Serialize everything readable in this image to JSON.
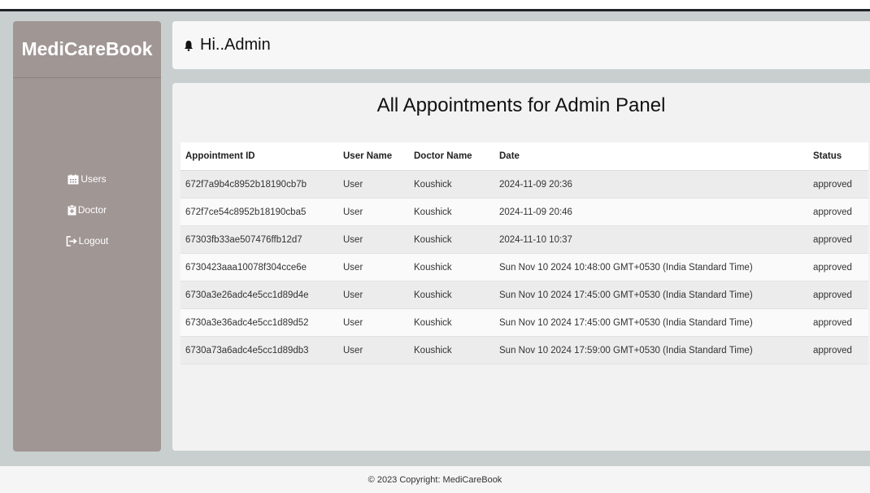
{
  "brand": "MediCareBook",
  "sidebar": {
    "items": [
      {
        "label": "Users",
        "icon": "calendar-icon"
      },
      {
        "label": "Doctor",
        "icon": "clipboard-icon"
      },
      {
        "label": "Logout",
        "icon": "logout-icon"
      }
    ]
  },
  "header": {
    "greeting": "Hi..Admin",
    "icon": "bell-icon"
  },
  "main": {
    "title": "All Appointments for Admin Panel",
    "columns": [
      "Appointment ID",
      "User Name",
      "Doctor Name",
      "Date",
      "Status"
    ],
    "rows": [
      [
        "672f7a9b4c8952b18190cb7b",
        "User",
        "Koushick",
        "2024-11-09 20:36",
        "approved"
      ],
      [
        "672f7ce54c8952b18190cba5",
        "User",
        "Koushick",
        "2024-11-09 20:46",
        "approved"
      ],
      [
        "67303fb33ae507476ffb12d7",
        "User",
        "Koushick",
        "2024-11-10 10:37",
        "approved"
      ],
      [
        "6730423aaa10078f304cce6e",
        "User",
        "Koushick",
        "Sun Nov 10 2024 10:48:00 GMT+0530 (India Standard Time)",
        "approved"
      ],
      [
        "6730a3e26adc4e5cc1d89d4e",
        "User",
        "Koushick",
        "Sun Nov 10 2024 17:45:00 GMT+0530 (India Standard Time)",
        "approved"
      ],
      [
        "6730a3e36adc4e5cc1d89d52",
        "User",
        "Koushick",
        "Sun Nov 10 2024 17:45:00 GMT+0530 (India Standard Time)",
        "approved"
      ],
      [
        "6730a73a6adc4e5cc1d89db3",
        "User",
        "Koushick",
        "Sun Nov 10 2024 17:59:00 GMT+0530 (India Standard Time)",
        "approved"
      ]
    ]
  },
  "footer": {
    "copyright": "© 2023 Copyright: MediCareBook"
  },
  "colors": {
    "sidebar": "#a09694",
    "background": "#c9cfcf",
    "panel": "#f2f2f2"
  }
}
